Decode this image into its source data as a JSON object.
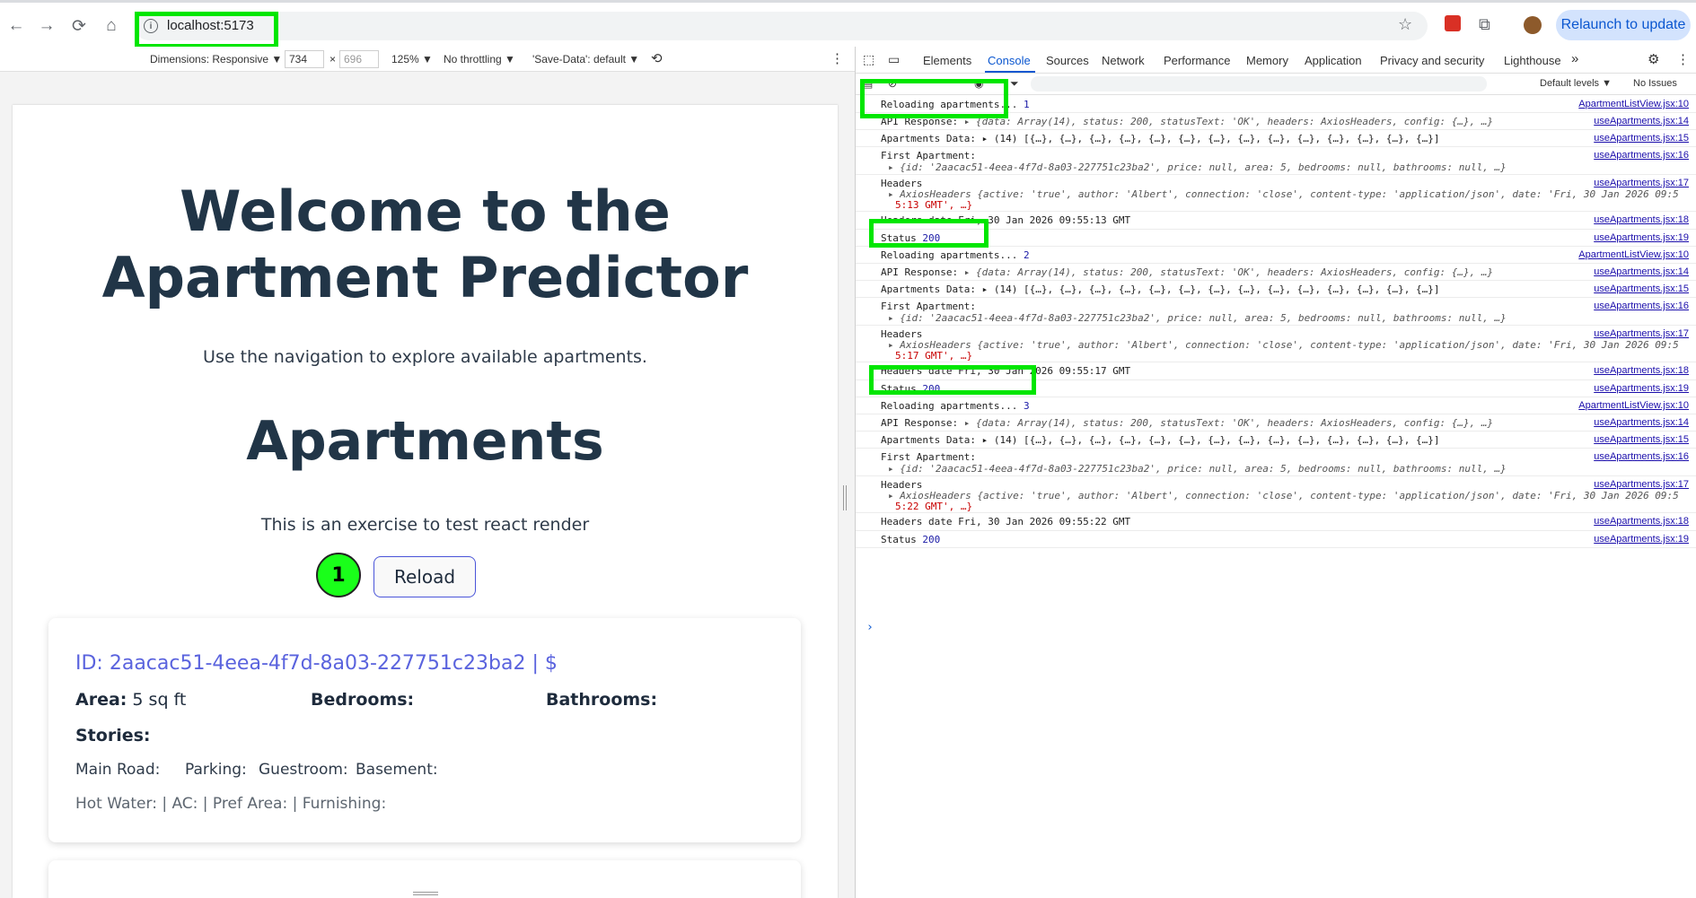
{
  "browser": {
    "url": "localhost:5173",
    "relaunch_label": "Relaunch to update"
  },
  "device_toolbar": {
    "dimensions_label": "Dimensions: Responsive ▼",
    "width": "734",
    "height": "696",
    "times": "×",
    "zoom": "125% ▼",
    "throttling": "No throttling ▼",
    "save_data": "'Save-Data': default ▼"
  },
  "devtools": {
    "tabs": [
      "Elements",
      "Console",
      "Sources",
      "Network",
      "Performance",
      "Memory",
      "Application",
      "Privacy and security",
      "Lighthouse"
    ],
    "more_tabs": "»",
    "default_levels": "Default levels ▼",
    "no_issues": "No Issues"
  },
  "console": {
    "reload1": "Reloading apartments...",
    "reload1_n": "1",
    "reload2_n": "2",
    "reload3_n": "3",
    "src_list": "ApartmentListView.jsx:10",
    "src14": "useApartments.jsx:14",
    "src15": "useApartments.jsx:15",
    "src16": "useApartments.jsx:16",
    "src17": "useApartments.jsx:17",
    "src18": "useApartments.jsx:18",
    "src19": "useApartments.jsx:19",
    "api_label": "API Response:",
    "api_value": "▸ {data: Array(14), status: 200, statusText: 'OK', headers: AxiosHeaders, config: {…}, …}",
    "data_label": "Apartments Data:",
    "data_value": "▸ (14) [{…}, {…}, {…}, {…}, {…}, {…}, {…}, {…}, {…}, {…}, {…}, {…}, {…}, {…}]",
    "first_label": "First Apartment:",
    "first_value": "▸ {id: '2aacac51-4eea-4f7d-8a03-227751c23ba2', price: null, area: 5, bedrooms: null, bathrooms: null, …}",
    "headers_label": "Headers",
    "headers_value": "▸ AxiosHeaders {active: 'true', author: 'Albert', connection: 'close', content-type: 'application/json', date: 'Fri, 30 Jan 2026 09:5",
    "headers_tail1": "5:13 GMT', …}",
    "headers_tail2": "5:17 GMT', …}",
    "headers_tail3": "5:22 GMT', …}",
    "date1": "Headers date Fri, 30 Jan 2026 09:55:13 GMT",
    "date2": "Headers date Fri, 30 Jan 2026 09:55:17 GMT",
    "date3": "Headers date Fri, 30 Jan 2026 09:55:22 GMT",
    "status_label": "Status",
    "status_value": "200",
    "prompt": "›"
  },
  "page": {
    "hero_title": "Welcome to the Apartment Predictor",
    "hero_subtitle": "Use the navigation to explore available apartments.",
    "section_title": "Apartments",
    "section_subtitle": "This is an exercise to test react render",
    "counter": "1",
    "reload_label": "Reload",
    "card": {
      "id_line": "ID: 2aacac51-4eea-4f7d-8a03-227751c23ba2 | $",
      "area_label": "Area:",
      "area_value": " 5 sq ft",
      "bedrooms_label": "Bedrooms:",
      "bathrooms_label": "Bathrooms:",
      "stories_label": "Stories:",
      "main_road": "Main Road:",
      "parking": "Parking:",
      "guestroom": "Guestroom:",
      "basement": "Basement:",
      "extras": "Hot Water: | AC: | Pref Area: | Furnishing:"
    }
  }
}
